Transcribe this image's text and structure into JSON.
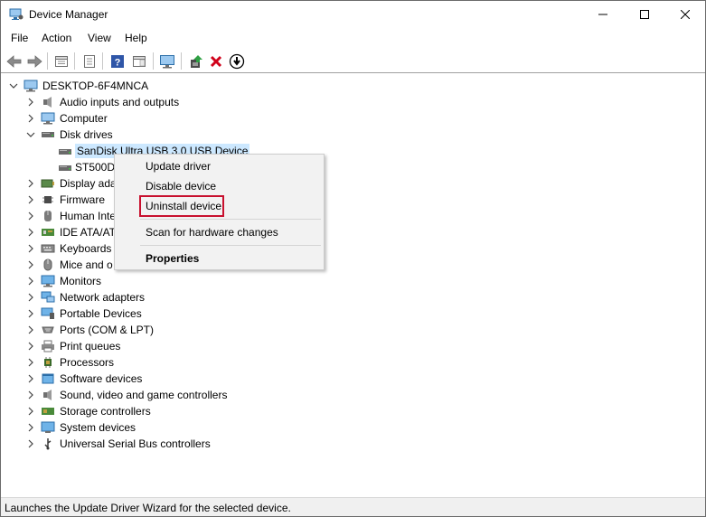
{
  "window": {
    "title": "Device Manager"
  },
  "menu": {
    "items": [
      "File",
      "Action",
      "View",
      "Help"
    ]
  },
  "toolbar": {
    "icons": [
      "back-arrow-icon",
      "forward-arrow-icon",
      "properties-sheet-icon",
      "device-list-icon",
      "help-icon",
      "action-pane-icon",
      "monitor-scan-icon",
      "update-driver-icon",
      "uninstall-x-icon",
      "download-circle-icon"
    ]
  },
  "tree": {
    "root": "DESKTOP-6F4MNCA",
    "categories": [
      "Audio inputs and outputs",
      "Computer",
      "Disk drives",
      "Display ada",
      "Firmware",
      "Human Inte",
      "IDE ATA/AT",
      "Keyboards",
      "Mice and o",
      "Monitors",
      "Network adapters",
      "Portable Devices",
      "Ports (COM & LPT)",
      "Print queues",
      "Processors",
      "Software devices",
      "Sound, video and game controllers",
      "Storage controllers",
      "System devices",
      "Universal Serial Bus controllers"
    ],
    "disk_children": [
      "SanDisk Ultra USB 3.0 USB Device",
      "ST500D"
    ]
  },
  "context_menu": {
    "update": "Update driver",
    "disable": "Disable device",
    "uninstall": "Uninstall device",
    "scan": "Scan for hardware changes",
    "properties": "Properties"
  },
  "status": {
    "text": "Launches the Update Driver Wizard for the selected device."
  },
  "colors": {
    "selection": "#cce8ff",
    "highlight_border": "#c8102e",
    "uninstall_red": "#d0021b"
  }
}
